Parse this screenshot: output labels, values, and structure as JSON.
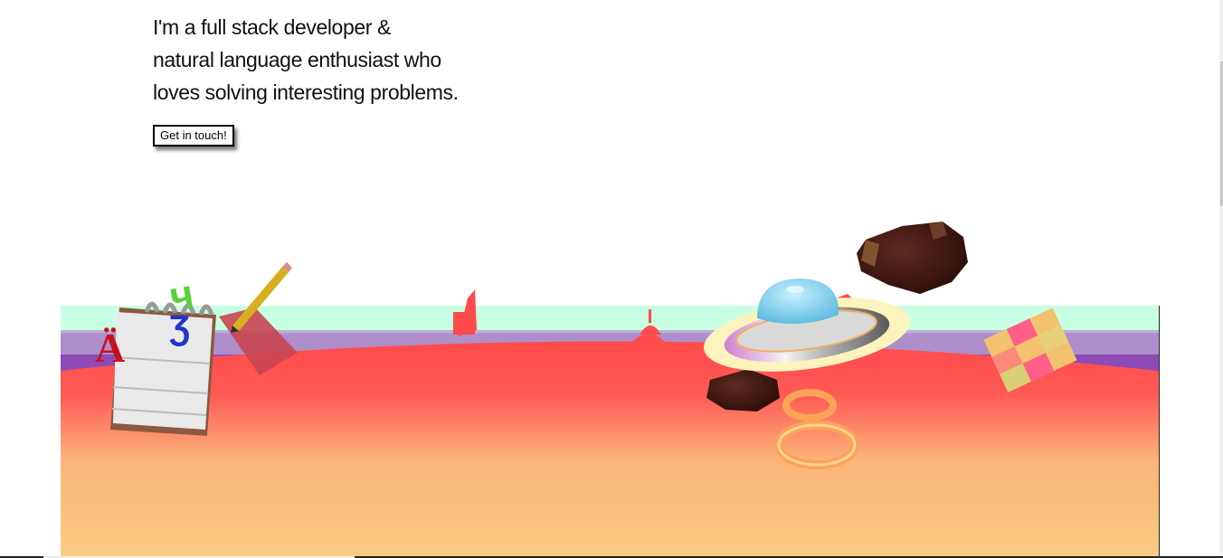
{
  "hero": {
    "lines": [
      "I'm a full stack developer &",
      "natural language enthusiast who",
      "loves solving interesting problems."
    ],
    "cta_label": "Get in touch!"
  },
  "scene": {
    "notebook_letters": [
      "Ä",
      "ч",
      "Ʒ"
    ],
    "colors": {
      "sky_top": "#c8ffe3",
      "horizon": "#8e4bb6",
      "ground_top": "#ff4b4b",
      "ground_bottom": "#f9cc82"
    },
    "icons": [
      "notebook-icon",
      "pencil-icon",
      "ufo-icon",
      "asteroid-icon",
      "rings-icon",
      "cube-icon",
      "landmark-silhouette-icon"
    ]
  }
}
